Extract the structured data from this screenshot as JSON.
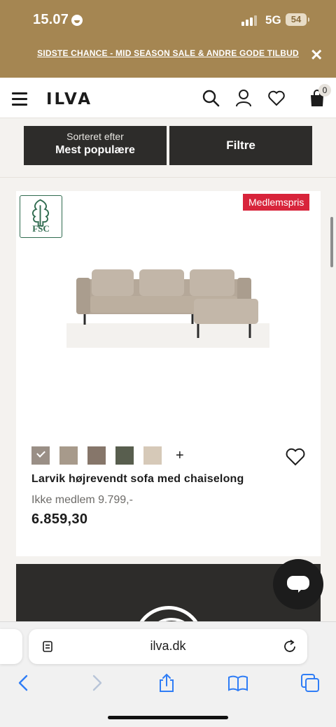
{
  "status_bar": {
    "time": "15.07",
    "network": "5G",
    "battery": "54"
  },
  "promo": {
    "text": "SIDSTE CHANCE - MID SEASON SALE & ANDRE GODE TILBUD",
    "close": "✕"
  },
  "header": {
    "logo": "ILVA",
    "cart_count": "0"
  },
  "sort": {
    "label_small": "Sorteret efter",
    "label_main": "Mest populære"
  },
  "filter": {
    "label": "Filtre"
  },
  "product": {
    "certification": "FSC",
    "badge": "Medlemspris",
    "name": "Larvik højrevendt sofa med chaiselong",
    "member_price_note": "Ikke medlem 9.799,-",
    "price": "6.859,30",
    "swatches": [
      {
        "color": "#9a8f86",
        "selected": true
      },
      {
        "color": "#a79a8b",
        "selected": false
      },
      {
        "color": "#86766a",
        "selected": false
      },
      {
        "color": "#585e4e",
        "selected": false
      },
      {
        "color": "#d6c9b8",
        "selected": false
      }
    ],
    "more_colors": "+"
  },
  "browser": {
    "url": "ilva.dk"
  },
  "colors": {
    "brand_band": "#a58652",
    "dark_button": "#2d2c2a",
    "badge_red": "#d8243b",
    "fsc_green": "#2f6b4f",
    "ios_blue": "#2f7df6"
  }
}
